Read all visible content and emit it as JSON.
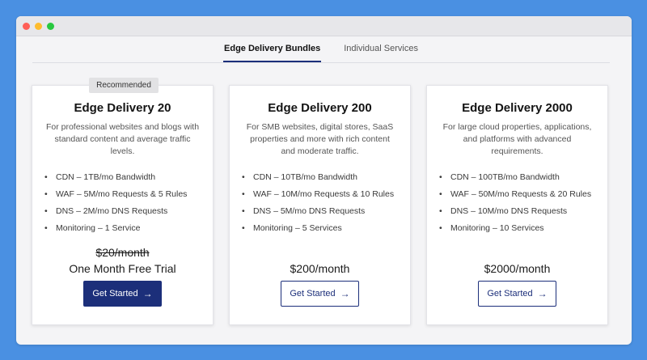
{
  "tabs": [
    {
      "label": "Edge Delivery Bundles",
      "active": true
    },
    {
      "label": "Individual Services",
      "active": false
    }
  ],
  "cards": [
    {
      "badge": "Recommended",
      "title": "Edge Delivery 20",
      "description": "For professional websites and blogs with standard content and average traffic levels.",
      "features": [
        "CDN – 1TB/mo Bandwidth",
        "WAF – 5M/mo Requests & 5 Rules",
        "DNS – 2M/mo DNS Requests",
        "Monitoring – 1 Service"
      ],
      "old_price": "$20/month",
      "price": "One Month Free Trial",
      "button": "Get Started"
    },
    {
      "title": "Edge Delivery 200",
      "description": "For SMB websites, digital stores, SaaS properties and more with rich content and moderate traffic.",
      "features": [
        "CDN – 10TB/mo Bandwidth",
        "WAF – 10M/mo Requests & 10 Rules",
        "DNS – 5M/mo DNS Requests",
        "Monitoring – 5 Services"
      ],
      "price": "$200/month",
      "button": "Get Started"
    },
    {
      "title": "Edge Delivery 2000",
      "description": "For large cloud properties, applications, and platforms with advanced requirements.",
      "features": [
        "CDN – 100TB/mo Bandwidth",
        "WAF – 50M/mo Requests & 20 Rules",
        "DNS – 10M/mo DNS Requests",
        "Monitoring – 10 Services"
      ],
      "price": "$2000/month",
      "button": "Get Started"
    }
  ],
  "bullet": "•",
  "arrow": "→",
  "colors": {
    "background": "#4a90e2",
    "accent": "#1c2f7a",
    "window": "#f4f4f6"
  }
}
